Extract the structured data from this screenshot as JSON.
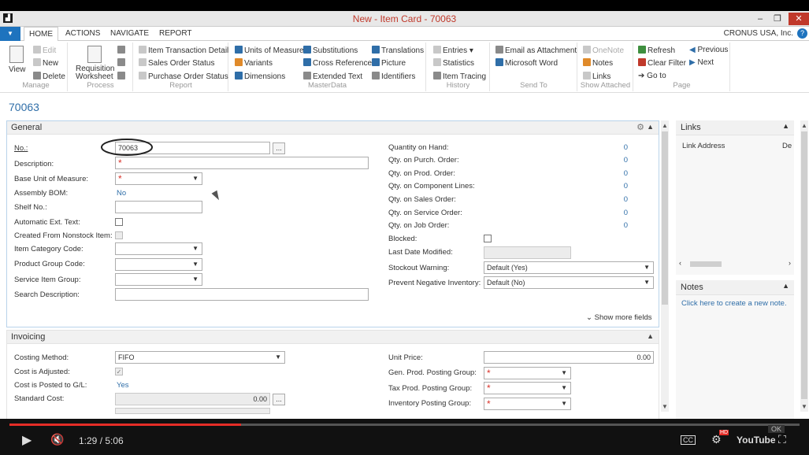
{
  "window": {
    "title": "New - Item Card - 70063",
    "controls": {
      "minimize": "–",
      "restore": "❐",
      "close": "✕"
    }
  },
  "ribbon_tabs": {
    "app_menu": "▼",
    "tabs": [
      "HOME",
      "ACTIONS",
      "NAVIGATE",
      "REPORT"
    ],
    "company": "CRONUS USA, Inc.",
    "help": "?"
  },
  "ribbon": {
    "manage": {
      "label": "Manage",
      "view": "View",
      "edit": "Edit",
      "new": "New",
      "delete": "Delete"
    },
    "process": {
      "label": "Process",
      "requisition": "Requisition Worksheet"
    },
    "report": {
      "label": "Report",
      "items": [
        "Item Transaction Detail",
        "Sales Order Status",
        "Purchase Order Status"
      ]
    },
    "masterdata": {
      "label": "MasterData",
      "col1": [
        "Units of Measure",
        "Variants",
        "Dimensions"
      ],
      "col2": [
        "Substitutions",
        "Cross References",
        "Extended Text"
      ],
      "col3": [
        "Translations",
        "Picture",
        "Identifiers"
      ]
    },
    "history": {
      "label": "History",
      "items": [
        "Entries ▾",
        "Statistics",
        "Item Tracing"
      ]
    },
    "sendto": {
      "label": "Send To",
      "items": [
        "Email as Attachment",
        "Microsoft Word"
      ]
    },
    "showattached": {
      "label": "Show Attached",
      "items": [
        "OneNote",
        "Notes",
        "Links"
      ]
    },
    "page": {
      "label": "Page",
      "col1": [
        "Refresh",
        "Clear Filter",
        "Go to"
      ],
      "col2": [
        "Previous",
        "Next"
      ]
    }
  },
  "item_no": "70063",
  "general": {
    "title": "General",
    "labels": {
      "no": "No.:",
      "description": "Description:",
      "base_uom": "Base Unit of Measure:",
      "assembly_bom": "Assembly BOM:",
      "shelf_no": "Shelf No.:",
      "auto_ext_text": "Automatic Ext. Text:",
      "created_nonstock": "Created From Nonstock Item:",
      "item_category": "Item Category Code:",
      "product_group": "Product Group Code:",
      "service_item_group": "Service Item Group:",
      "search_description": "Search Description:"
    },
    "values": {
      "no": "70063",
      "assembly_bom": "No",
      "ellipsis": "..."
    },
    "right_labels": {
      "qty_on_hand": "Quantity on Hand:",
      "qty_purch": "Qty. on Purch. Order:",
      "qty_prod": "Qty. on Prod. Order:",
      "qty_comp": "Qty. on Component Lines:",
      "qty_sales": "Qty. on Sales Order:",
      "qty_service": "Qty. on Service Order:",
      "qty_job": "Qty. on Job Order:",
      "blocked": "Blocked:",
      "last_modified": "Last Date Modified:",
      "stockout": "Stockout Warning:",
      "prevent_neg": "Prevent Negative Inventory:"
    },
    "right_values": {
      "qty_on_hand": "0",
      "qty_purch": "0",
      "qty_prod": "0",
      "qty_comp": "0",
      "qty_sales": "0",
      "qty_service": "0",
      "qty_job": "0",
      "stockout": "Default (Yes)",
      "prevent_neg": "Default (No)"
    },
    "show_more": "Show more fields"
  },
  "invoicing": {
    "title": "Invoicing",
    "labels": {
      "costing_method": "Costing Method:",
      "cost_adjusted": "Cost is Adjusted:",
      "cost_posted": "Cost is Posted to G/L:",
      "standard_cost": "Standard Cost:",
      "unit_price": "Unit Price:",
      "gen_prod": "Gen. Prod. Posting Group:",
      "tax_prod": "Tax Prod. Posting Group:",
      "inv_posting": "Inventory Posting Group:"
    },
    "values": {
      "costing_method": "FIFO",
      "cost_posted": "Yes",
      "standard_cost": "0.00",
      "unit_price": "0.00"
    }
  },
  "links_box": {
    "title": "Links",
    "col_address": "Link Address",
    "col_more": "De"
  },
  "notes_box": {
    "title": "Notes",
    "link": "Click here to create a new note."
  },
  "player": {
    "time": "1:29 / 5:06",
    "progress": 0.2929,
    "hd": "HD",
    "yt": "YouTube",
    "cc": "CC",
    "ok": "OK"
  }
}
